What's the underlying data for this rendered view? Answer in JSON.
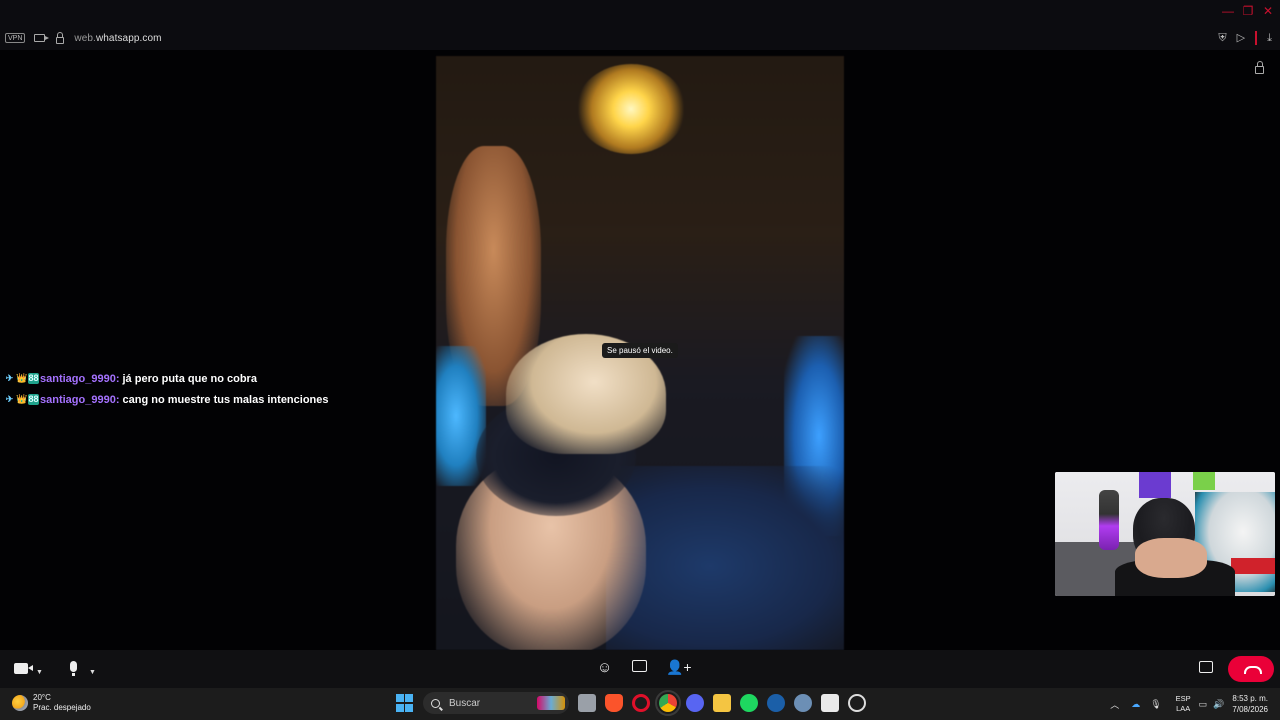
{
  "browser": {
    "vpn_label": "VPN",
    "url_prefix": "web.",
    "url_domain": "whatsapp.com"
  },
  "call": {
    "paused_notice": "Se pausó el video.",
    "accent_color": "#ea0038"
  },
  "chat": [
    {
      "badges": [
        "✈",
        "👑",
        "88"
      ],
      "user": "santiago_9990",
      "message": "já pero puta que no cobra"
    },
    {
      "badges": [
        "✈",
        "👑",
        "88"
      ],
      "user": "santiago_9990",
      "message": "cang no muestre tus malas intenciones"
    }
  ],
  "taskbar": {
    "weather_temp": "20°C",
    "weather_desc": "Prac. despejado",
    "search_placeholder": "Buscar",
    "lang_top": "ESP",
    "lang_bottom": "LAA",
    "time": "8:53 p. m.",
    "date": "7/08/2026"
  }
}
